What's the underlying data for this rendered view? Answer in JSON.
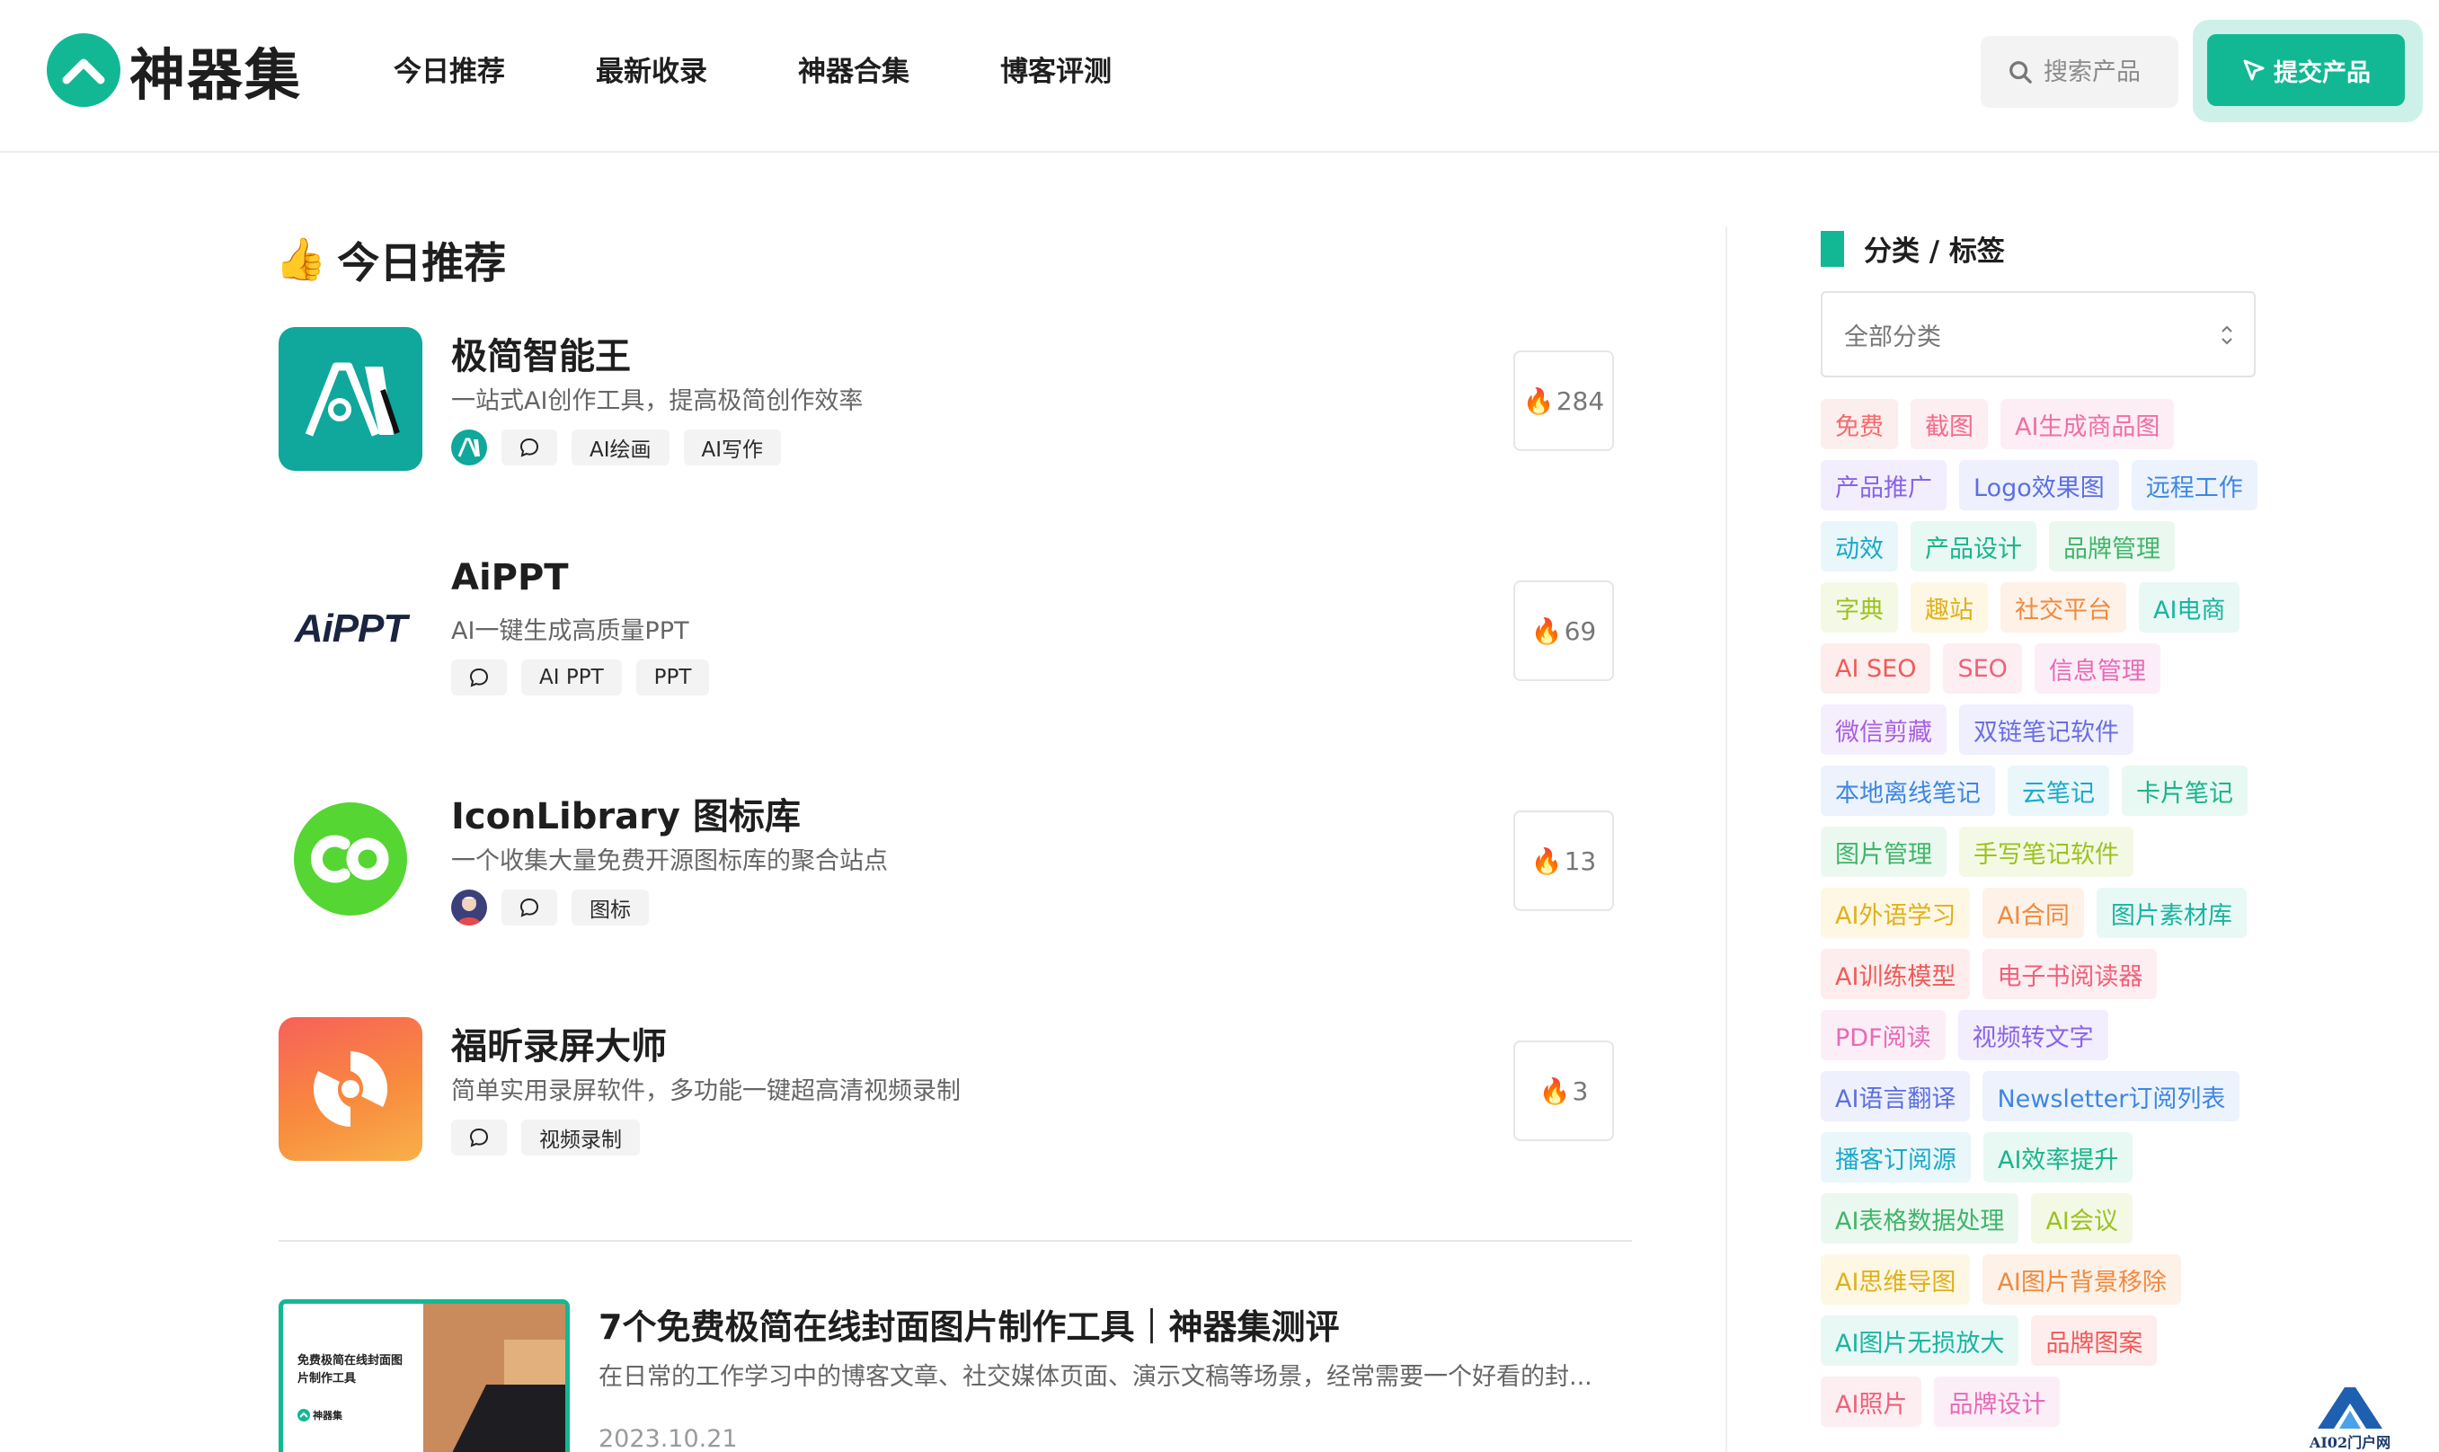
{
  "header": {
    "logo_text": "神器集",
    "nav": [
      "今日推荐",
      "最新收录",
      "神器合集",
      "博客评测"
    ],
    "search_placeholder": "搜索产品",
    "submit_label": "提交产品"
  },
  "main": {
    "section_title": "今日推荐",
    "products": [
      {
        "name": "极简智能王",
        "desc": "一站式AI创作工具，提高极简创作效率",
        "tags": [
          "AI绘画",
          "AI写作"
        ],
        "hot": "284"
      },
      {
        "name": "AiPPT",
        "desc": "AI一键生成高质量PPT",
        "tags": [
          "AI PPT",
          "PPT"
        ],
        "hot": "69"
      },
      {
        "name": "IconLibrary 图标库",
        "desc": "一个收集大量免费开源图标库的聚合站点",
        "tags": [
          "图标"
        ],
        "hot": "13"
      },
      {
        "name": "福昕录屏大师",
        "desc": "简单实用录屏软件，多功能一键超高清视频录制",
        "tags": [
          "视频录制"
        ],
        "hot": "3"
      }
    ],
    "logo_texts": {
      "aippt": "AiPPT"
    },
    "blog": {
      "title": "7个免费极简在线封面图片制作工具｜神器集测评",
      "desc": "在日常的工作学习中的博客文章、社交媒体页面、演示文稿等场景，经常需要一个好看的封...",
      "date": "2023.10.21",
      "cover_text": "免费极简在线封面图片制作工具",
      "cover_brand": "神器集"
    }
  },
  "sidebar": {
    "title": "分类 / 标签",
    "select_value": "全部分类",
    "tags": [
      {
        "label": "免费",
        "color": "#f36b6b",
        "bg": "#fdeeee"
      },
      {
        "label": "截图",
        "color": "#f36b8a",
        "bg": "#fdeef2"
      },
      {
        "label": "AI生成商品图",
        "color": "#ef6fa3",
        "bg": "#fdeef5"
      },
      {
        "label": "产品推广",
        "color": "#8a63e6",
        "bg": "#f2eefd"
      },
      {
        "label": "Logo效果图",
        "color": "#5b6fe0",
        "bg": "#eef0fd"
      },
      {
        "label": "远程工作",
        "color": "#3f86e0",
        "bg": "#ecf3fd"
      },
      {
        "label": "动效",
        "color": "#1aa9c9",
        "bg": "#e9f7fb"
      },
      {
        "label": "产品设计",
        "color": "#19b58b",
        "bg": "#e8f8f3"
      },
      {
        "label": "品牌管理",
        "color": "#3fb56a",
        "bg": "#ebf8ef"
      },
      {
        "label": "字典",
        "color": "#9cc21e",
        "bg": "#f4f9e6"
      },
      {
        "label": "趣站",
        "color": "#e0b11a",
        "bg": "#fdf7e4"
      },
      {
        "label": "社交平台",
        "color": "#f08a3c",
        "bg": "#fdf1e8"
      },
      {
        "label": "AI电商",
        "color": "#19b5a0",
        "bg": "#e8f8f5"
      },
      {
        "label": "AI SEO",
        "color": "#f05a5a",
        "bg": "#fdeded"
      },
      {
        "label": "SEO",
        "color": "#f0607a",
        "bg": "#fdeef1"
      },
      {
        "label": "信息管理",
        "color": "#e66ab8",
        "bg": "#fceef7"
      },
      {
        "label": "微信剪藏",
        "color": "#a85fe0",
        "bg": "#f5eefd"
      },
      {
        "label": "双链笔记软件",
        "color": "#6a6fe0",
        "bg": "#efeffd"
      },
      {
        "label": "本地离线笔记",
        "color": "#3f86e0",
        "bg": "#ecf3fd"
      },
      {
        "label": "云笔记",
        "color": "#1aa9c9",
        "bg": "#e9f7fb"
      },
      {
        "label": "卡片笔记",
        "color": "#19b58b",
        "bg": "#e8f8f3"
      },
      {
        "label": "图片管理",
        "color": "#3fb56a",
        "bg": "#ebf8ef"
      },
      {
        "label": "手写笔记软件",
        "color": "#9cc21e",
        "bg": "#f4f9e6"
      },
      {
        "label": "AI外语学习",
        "color": "#e0b11a",
        "bg": "#fdf7e4"
      },
      {
        "label": "AI合同",
        "color": "#f08a3c",
        "bg": "#fdf1e8"
      },
      {
        "label": "图片素材库",
        "color": "#19b5a0",
        "bg": "#e8f8f5"
      },
      {
        "label": "AI训练模型",
        "color": "#f05a5a",
        "bg": "#fdeded"
      },
      {
        "label": "电子书阅读器",
        "color": "#f0607a",
        "bg": "#fdeef1"
      },
      {
        "label": "PDF阅读",
        "color": "#e66ab8",
        "bg": "#fceef7"
      },
      {
        "label": "视频转文字",
        "color": "#8a63e6",
        "bg": "#f2eefd"
      },
      {
        "label": "AI语言翻译",
        "color": "#5b6fe0",
        "bg": "#eef0fd"
      },
      {
        "label": "Newsletter订阅列表",
        "color": "#3f86e0",
        "bg": "#ecf3fd"
      },
      {
        "label": "播客订阅源",
        "color": "#1aa9c9",
        "bg": "#e9f7fb"
      },
      {
        "label": "AI效率提升",
        "color": "#19b58b",
        "bg": "#e8f8f3"
      },
      {
        "label": "AI表格数据处理",
        "color": "#3fb56a",
        "bg": "#ebf8ef"
      },
      {
        "label": "AI会议",
        "color": "#9cc21e",
        "bg": "#f4f9e6"
      },
      {
        "label": "AI思维导图",
        "color": "#e0b11a",
        "bg": "#fdf7e4"
      },
      {
        "label": "AI图片背景移除",
        "color": "#f08a3c",
        "bg": "#fdf1e8"
      },
      {
        "label": "AI图片无损放大",
        "color": "#19b5a0",
        "bg": "#e8f8f5"
      },
      {
        "label": "品牌图案",
        "color": "#f05a5a",
        "bg": "#fdeded"
      },
      {
        "label": "AI照片",
        "color": "#f0607a",
        "bg": "#fdeef1"
      },
      {
        "label": "品牌设计",
        "color": "#e66ab8",
        "bg": "#fceef7"
      }
    ]
  },
  "watermark": {
    "text": "AI02门户网"
  },
  "colors": {
    "brand": "#12b893",
    "text": "#1e1e1e",
    "muted": "#666666"
  }
}
